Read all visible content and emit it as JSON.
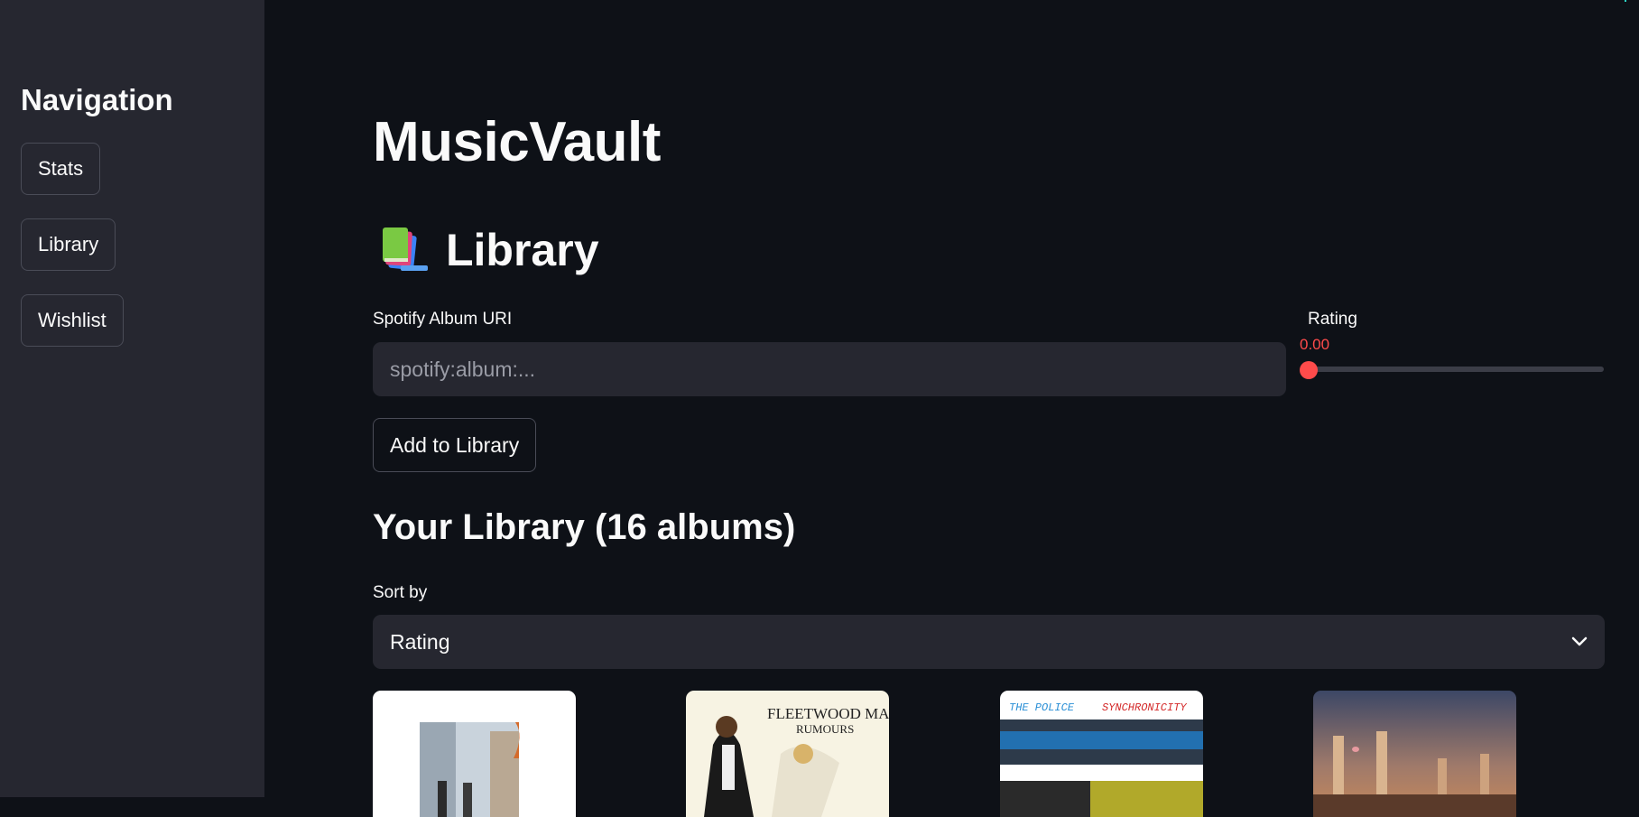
{
  "sidebar": {
    "title": "Navigation",
    "items": [
      {
        "label": "Stats"
      },
      {
        "label": "Library"
      },
      {
        "label": "Wishlist"
      }
    ]
  },
  "main": {
    "app_title": "MusicVault",
    "section": {
      "icon": "books-icon",
      "title": "Library"
    },
    "uri_field": {
      "label": "Spotify Album URI",
      "placeholder": "spotify:album:...",
      "value": ""
    },
    "rating": {
      "label": "Rating",
      "value_text": "0.00",
      "value": 0.0
    },
    "add_button": "Add to Library",
    "library_heading": "Your Library (16 albums)",
    "sort": {
      "label": "Sort by",
      "selected": "Rating"
    },
    "albums": [
      {
        "cover_text": ""
      },
      {
        "cover_text": "FLEETWOOD MAC",
        "cover_subtext": "RUMOURS"
      },
      {
        "cover_text": "THE POLICE",
        "cover_subtext": "SYNCHRONICITY"
      },
      {
        "cover_text": ""
      }
    ]
  },
  "colors": {
    "background": "#0e1117",
    "sidebar": "#262730",
    "accent": "#ff4b4b",
    "text": "#fafafa"
  }
}
